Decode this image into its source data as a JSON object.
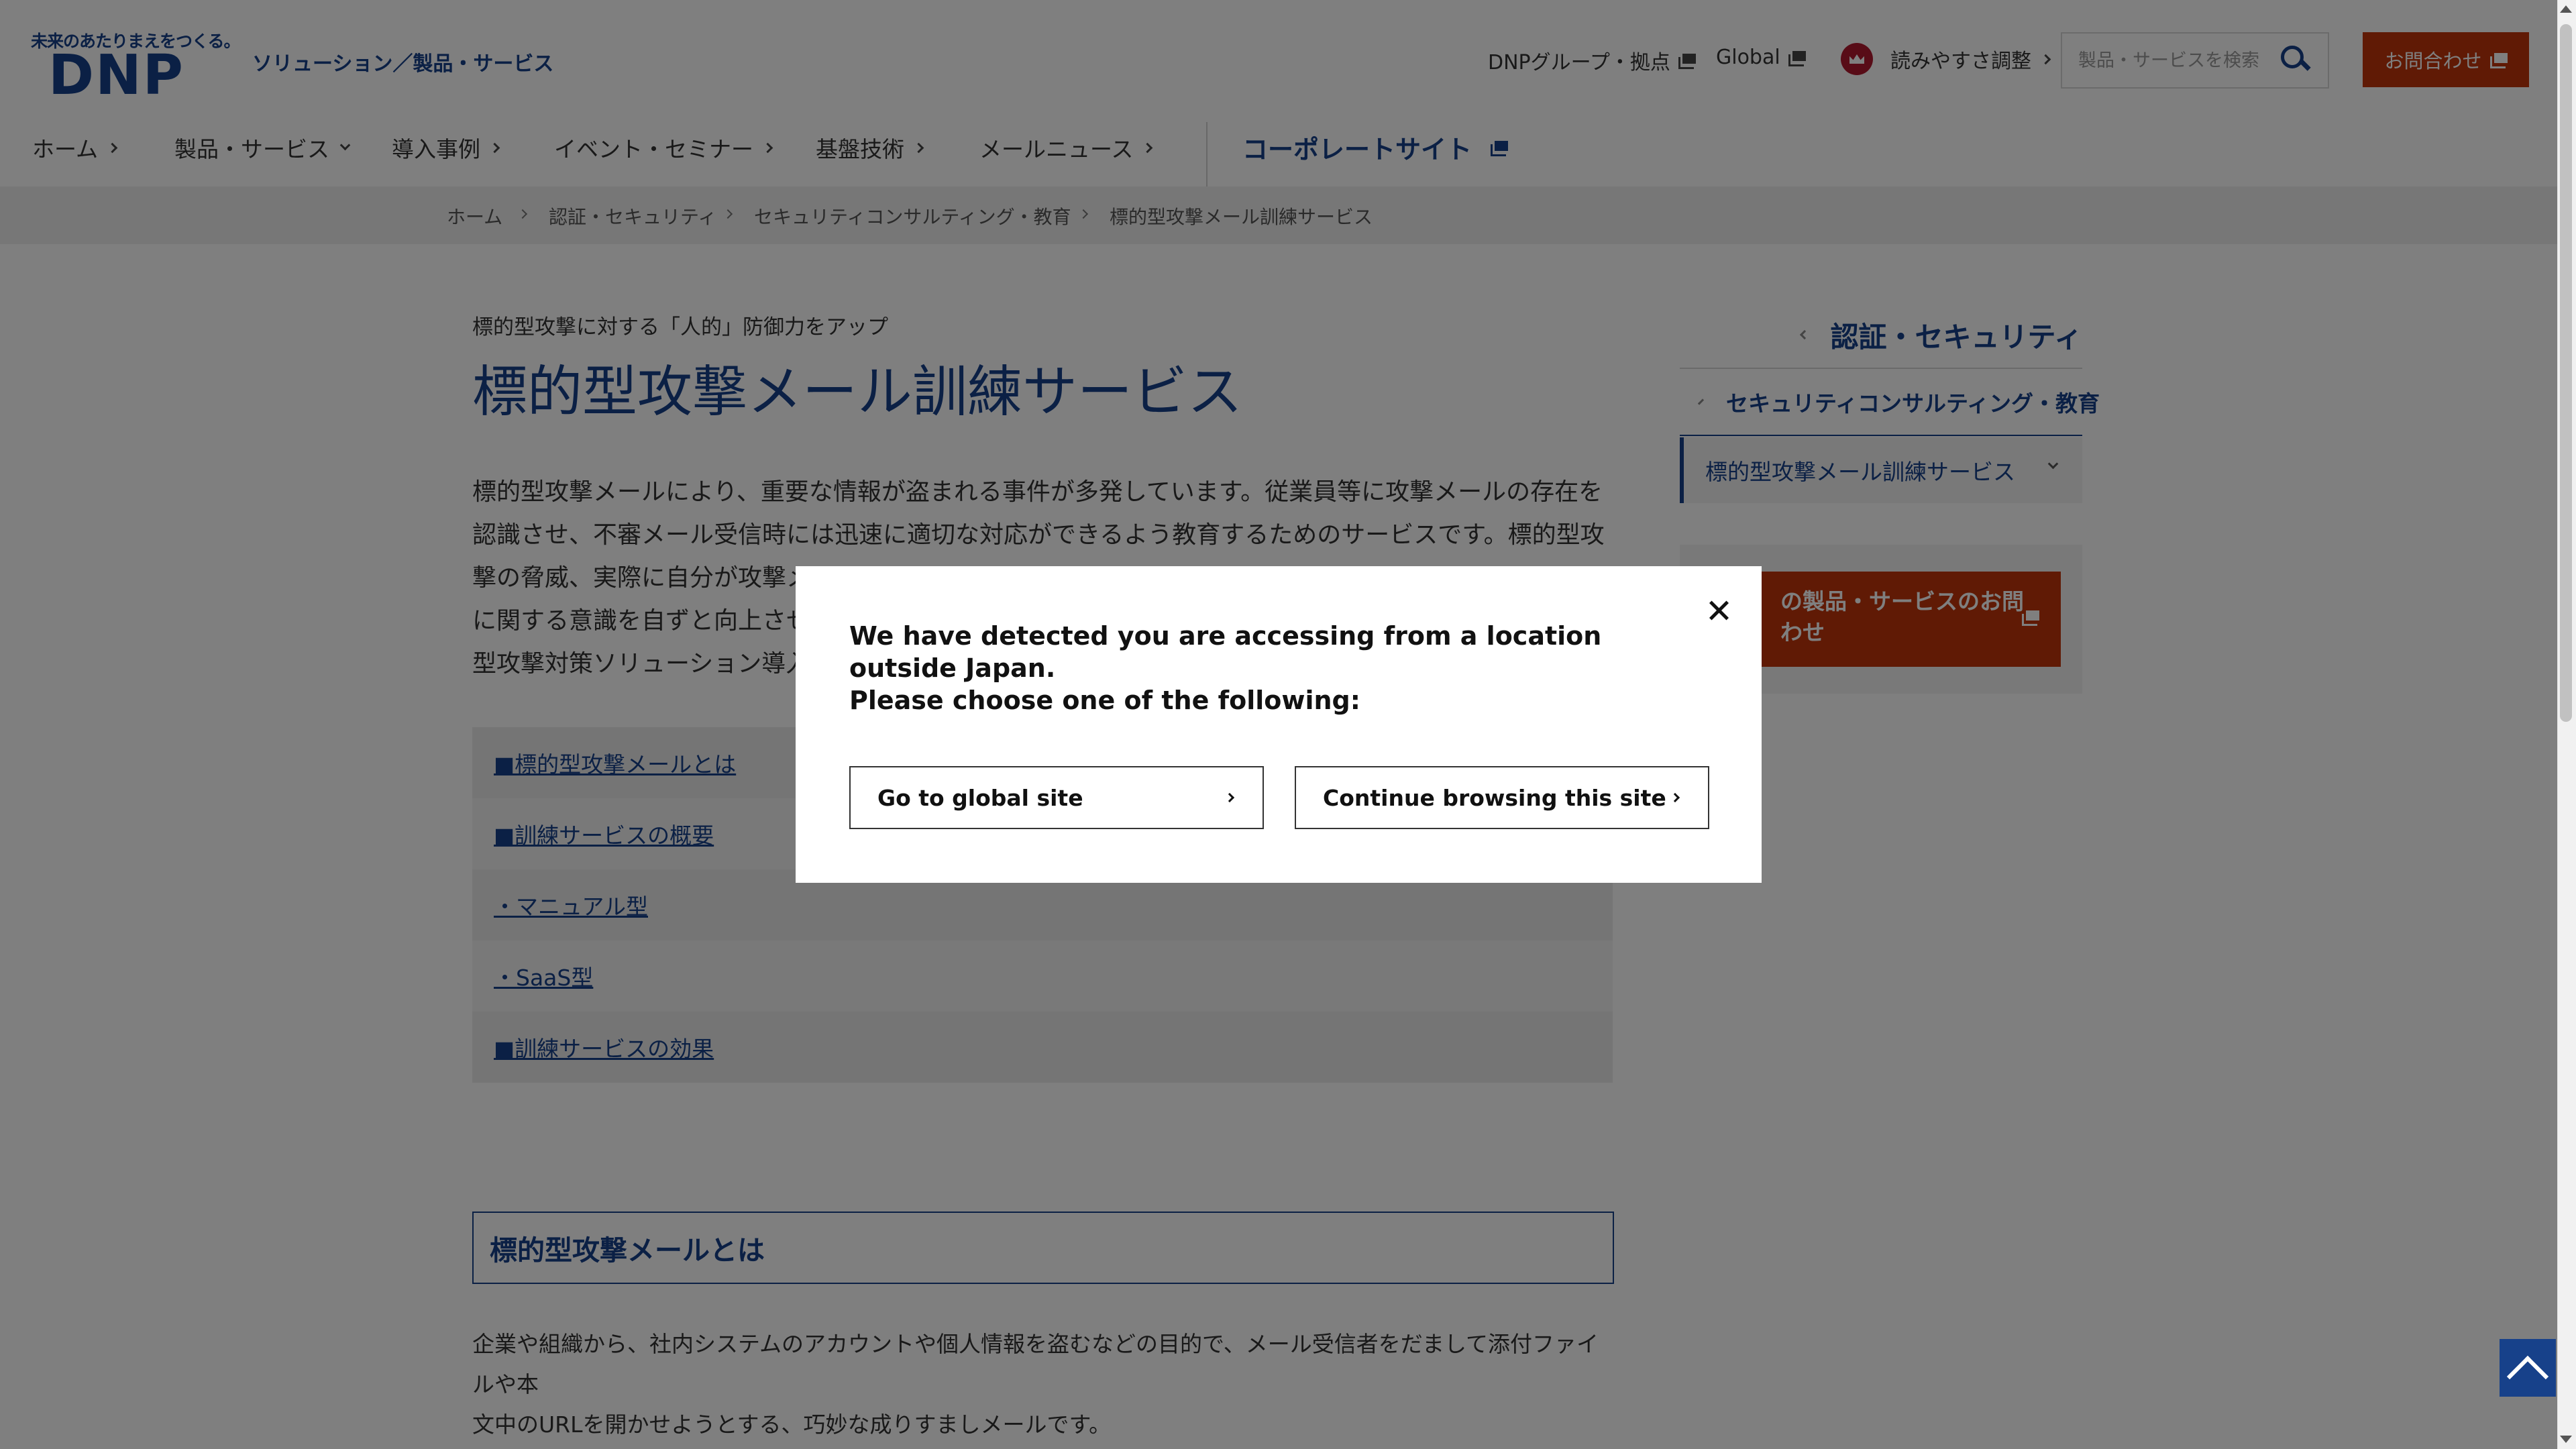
{
  "header": {
    "logo_tagline": "未来のあたりまえをつくる。",
    "logo_text": "DNP",
    "section_title": "ソリューション／製品・サービス",
    "util_links": {
      "group": "DNPグループ・拠点",
      "global": "Global",
      "readability": "読みやすさ調整"
    },
    "search_placeholder": "製品・サービスを検索",
    "contact_label": "お問合わせ"
  },
  "nav": {
    "home": "ホーム",
    "products": "製品・サービス",
    "cases": "導入事例",
    "events": "イベント・セミナー",
    "technology": "基盤技術",
    "mail_news": "メールニュース",
    "corporate": "コーポレートサイト"
  },
  "breadcrumb": {
    "home": "ホーム",
    "auth_security": "認証・セキュリティ",
    "consulting": "セキュリティコンサルティング・教育",
    "current": "標的型攻撃メール訓練サービス"
  },
  "main": {
    "lead": "標的型攻撃に対する「人的」防御力をアップ",
    "title": "標的型攻撃メール訓練サービス",
    "body_lines": [
      "標的型攻撃メールにより、重要な情報が盗まれる事件が多発しています。従業員等に攻撃メールの存在を",
      "認識させ、不審メール受信時には迅速に適切な対応ができるよう教育するためのサービスです。標的型攻",
      "撃の脅威、実際に自分が攻撃メ",
      "に関する意識を自ずと向上させ",
      "型攻撃対策ソリューション導入"
    ],
    "toc": [
      "■標的型攻撃メールとは",
      "■訓練サービスの概要",
      "・マニュアル型",
      "・SaaS型",
      "■訓練サービスの効果"
    ],
    "section_heading": "標的型攻撃メールとは",
    "section_body_lines": [
      "企業や組織から、社内システムのアカウントや個人情報を盗むなどの目的で、メール受信者をだまして添付ファイルや本",
      "文中のURLを開かせようとする、巧妙な成りすましメールです。"
    ]
  },
  "sidebar": {
    "category": "認証・セキュリティ",
    "subcategory": "セキュリティコンサルティング・教育",
    "current": "標的型攻撃メール訓練サービス",
    "contact_lines": [
      "の製品・サービスのお問",
      "わせ"
    ]
  },
  "modal": {
    "message_line1": "We have detected you are accessing from a location outside Japan.",
    "message_line2": "Please choose one of the following:",
    "global_button": "Go to global site",
    "continue_button": "Continue browsing this site"
  },
  "colors": {
    "brand_blue": "#17418a",
    "accent_red": "#c0340b",
    "overlay": "rgba(0,0,0,0.5)"
  }
}
